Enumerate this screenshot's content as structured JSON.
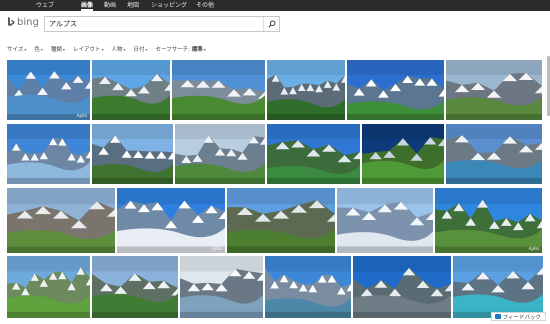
{
  "nav": {
    "tabs": [
      {
        "label": "ウェブ",
        "active": false
      },
      {
        "label": "画像",
        "active": true
      },
      {
        "label": "動画",
        "active": false
      },
      {
        "label": "地図",
        "active": false
      },
      {
        "label": "ショッピング",
        "active": false
      },
      {
        "label": "その他",
        "active": false
      }
    ]
  },
  "brand": {
    "name": "bing"
  },
  "search": {
    "query": "アルプス",
    "button_icon": "search-icon"
  },
  "filters": {
    "items": [
      "サイズ",
      "色",
      "種類",
      "レイアウト",
      "人物",
      "日付"
    ],
    "safe_label": "セーフサーチ:",
    "safe_value": "標準"
  },
  "images": {
    "watermark": "Apfel",
    "rows": [
      [
        "alpine-lake-snowy-peaks",
        "matterhorn-green-valley",
        "snowy-ridge-meadow",
        "matterhorn-forest",
        "village-green-slopes",
        "snowy-mountain-grass"
      ],
      [
        "snowy-range-panorama",
        "snowy-peak-forest",
        "valley-alpine-village",
        "blue-lake-village",
        "green-alpine-hillside",
        "mountain-lake-reflection"
      ],
      [
        "rocky-mountain-pasture",
        "ski-resort-gondola",
        "green-valley-peak",
        "snow-peaks-clouds",
        "hiker-mountain-summit"
      ],
      [
        "alpine-chalet-green",
        "hilltop-chapel-alps",
        "snowy-massif",
        "snowy-peaks-river",
        "turquoise-glacial-lake",
        "distant-snow-range"
      ]
    ]
  },
  "feedback": {
    "label": "フィードバック"
  }
}
